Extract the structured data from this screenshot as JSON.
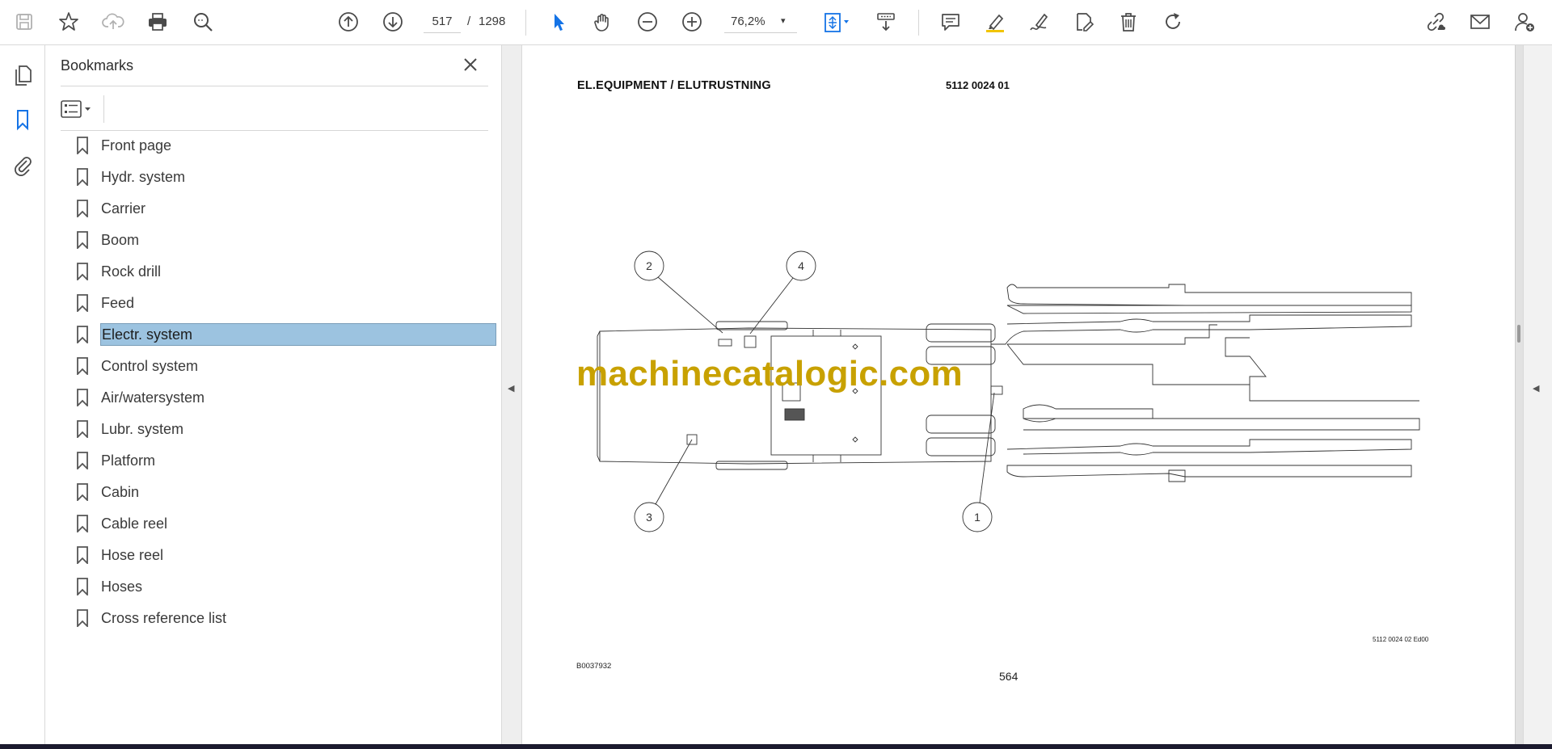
{
  "toolbar": {
    "current_page": "517",
    "page_separator": "/",
    "total_pages": "1298",
    "zoom": "76,2%",
    "zoom_caret": "▾",
    "accent": "#1473e6"
  },
  "bookmarks": {
    "title": "Bookmarks",
    "items": [
      {
        "label": "Front page"
      },
      {
        "label": "Hydr. system"
      },
      {
        "label": "Carrier"
      },
      {
        "label": "Boom"
      },
      {
        "label": "Rock drill"
      },
      {
        "label": "Feed"
      },
      {
        "label": "Electr. system",
        "selected": true
      },
      {
        "label": "Control system"
      },
      {
        "label": "Air/watersystem"
      },
      {
        "label": "Lubr. system"
      },
      {
        "label": "Platform"
      },
      {
        "label": "Cabin"
      },
      {
        "label": "Cable reel"
      },
      {
        "label": "Hose reel"
      },
      {
        "label": "Hoses"
      },
      {
        "label": "Cross reference list"
      }
    ]
  },
  "document": {
    "header_left": "EL.EQUIPMENT / ELUTRUSTNING",
    "header_right": "5112 0024 01",
    "callouts": [
      "2",
      "4",
      "3",
      "1"
    ],
    "watermark": "machinecatalogic.com",
    "drawing_ref": "5112 0024 02 Ed00",
    "image_ref": "B0037932",
    "page_number": "564"
  },
  "splitter": {
    "left_arrow": "◀",
    "right_arrow": "◀"
  }
}
